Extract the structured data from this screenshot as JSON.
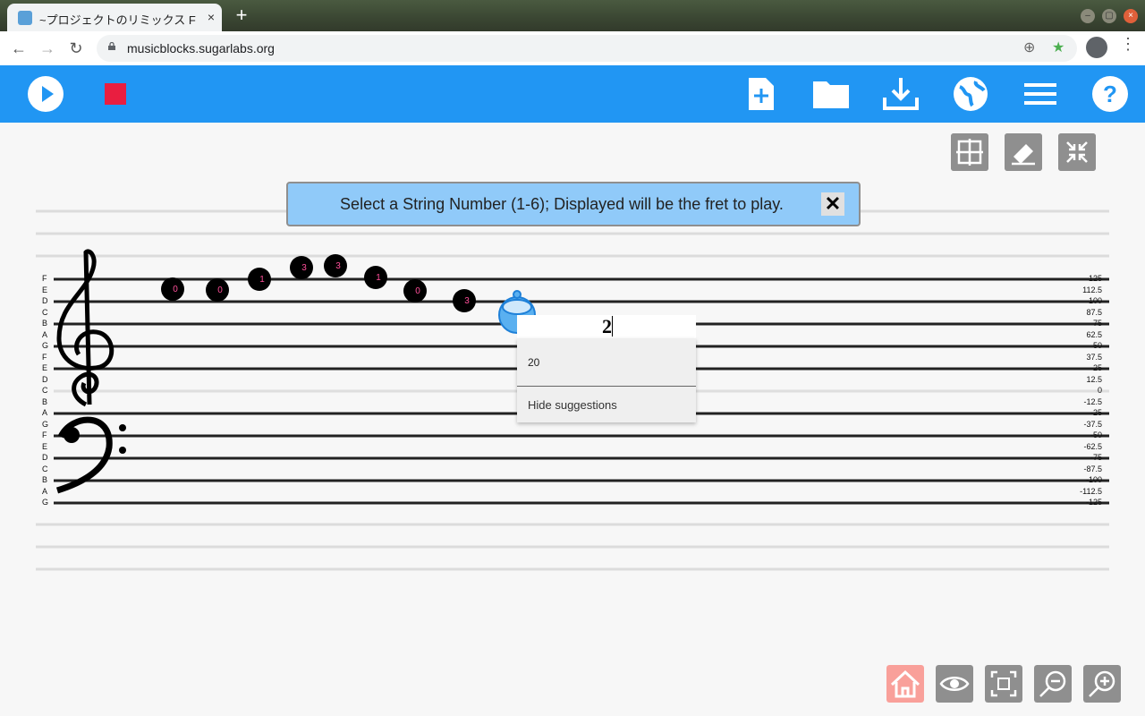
{
  "browser": {
    "tab_title": "~プロジェクトのリミックス Fin",
    "tab_close": "×",
    "new_tab": "+",
    "url": "musicblocks.sugarlabs.org",
    "win_minimize": "–",
    "win_maximize": "▢",
    "win_close": "×"
  },
  "toast": {
    "message": "Select a String Number (1-6); Displayed will be the fret to play.",
    "close_label": "✕"
  },
  "input": {
    "value": "2"
  },
  "suggestions": {
    "items": [
      "20"
    ],
    "hide": "Hide suggestions"
  },
  "staff": {
    "left_labels": [
      "F",
      "E",
      "D",
      "C",
      "B",
      "A",
      "G",
      "F",
      "E",
      "D",
      "C",
      "B",
      "A",
      "G",
      "F",
      "E",
      "D",
      "C",
      "B",
      "A",
      "G"
    ],
    "right_labels": [
      "125",
      "112.5",
      "100",
      "87.5",
      "75",
      "62.5",
      "50",
      "37.5",
      "25",
      "12.5",
      "0",
      "-12.5",
      "-25",
      "-37.5",
      "-50",
      "-62.5",
      "-75",
      "-87.5",
      "-100",
      "-112.5",
      "-125"
    ]
  },
  "notes": [
    "0",
    "0",
    "1",
    "3",
    "3",
    "1",
    "0",
    "3"
  ],
  "colors": {
    "header": "#2196f3",
    "stop": "#e91e40",
    "note_label": "#ff4f9a",
    "banner": "#90caf9"
  }
}
